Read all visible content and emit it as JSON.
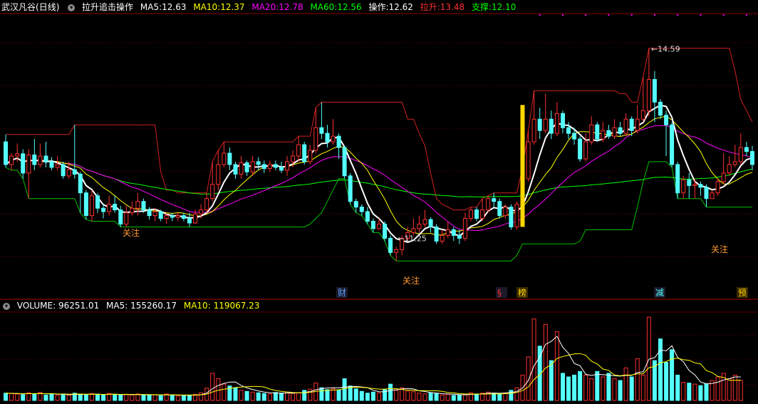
{
  "price_header": {
    "name": "武汉凡谷",
    "period": "(日线)",
    "indicator": "拉升追击操作",
    "ma5": {
      "label": "MA5:",
      "value": "12.63",
      "color": "#ffffff"
    },
    "ma10": {
      "label": "MA10:",
      "value": "12.37",
      "color": "#ffff00"
    },
    "ma20": {
      "label": "MA20:",
      "value": "12.78",
      "color": "#ff00ff"
    },
    "ma60": {
      "label": "MA60:",
      "value": "12.56",
      "color": "#00ff00"
    },
    "op": {
      "label": "操作:",
      "value": "12.62",
      "color": "#ffffff"
    },
    "lift": {
      "label": "拉升:",
      "value": "13.48",
      "color": "#ff3030"
    },
    "support": {
      "label": "支撑:",
      "value": "12.10",
      "color": "#00ff00"
    }
  },
  "volume_header": {
    "volume": {
      "label": "VOLUME:",
      "value": "96251.01",
      "color": "#ffffff"
    },
    "ma5": {
      "label": "MA5:",
      "value": "155260.17",
      "color": "#ffffff"
    },
    "ma10": {
      "label": "MA10:",
      "value": "119067.23",
      "color": "#ffff00"
    }
  },
  "chart_data": [
    {
      "type": "candlestick",
      "title": "武汉凡谷(日线)",
      "ylim": [
        10.3,
        15.2
      ],
      "grid": true,
      "up_color": "#ff3030",
      "down_color": "#54ffff",
      "candles": [
        [
          12.95,
          12.55,
          13.08,
          12.5
        ],
        [
          12.55,
          12.7,
          12.75,
          12.45
        ],
        [
          12.7,
          12.74,
          12.92,
          12.6
        ],
        [
          12.74,
          12.4,
          12.82,
          12.3
        ],
        [
          12.4,
          12.72,
          12.82,
          11.95
        ],
        [
          12.72,
          12.55,
          13.0,
          12.45
        ],
        [
          12.55,
          12.7,
          12.92,
          12.5
        ],
        [
          12.7,
          12.6,
          12.95,
          12.5
        ],
        [
          12.6,
          12.5,
          12.68,
          12.45
        ],
        [
          12.5,
          12.55,
          12.7,
          12.45
        ],
        [
          12.55,
          12.35,
          12.6,
          12.3
        ],
        [
          12.35,
          12.46,
          12.6,
          12.3
        ],
        [
          12.46,
          12.38,
          13.25,
          12.3
        ],
        [
          12.38,
          12.05,
          12.42,
          11.7
        ],
        [
          12.05,
          11.65,
          12.1,
          11.58
        ],
        [
          11.65,
          12.0,
          12.1,
          11.55
        ],
        [
          12.0,
          11.78,
          12.05,
          11.7
        ],
        [
          11.78,
          11.72,
          11.85,
          11.6
        ],
        [
          11.72,
          11.85,
          12.0,
          11.65
        ],
        [
          11.85,
          11.75,
          12.0,
          11.7
        ],
        [
          11.75,
          11.5,
          11.82,
          11.45
        ],
        [
          11.5,
          11.7,
          11.82,
          11.45
        ],
        [
          11.7,
          11.78,
          11.9,
          11.65
        ],
        [
          11.78,
          11.9,
          12.05,
          11.65
        ],
        [
          11.9,
          11.75,
          11.95,
          11.7
        ],
        [
          11.75,
          11.65,
          11.8,
          11.58
        ],
        [
          11.65,
          11.72,
          11.78,
          11.55
        ],
        [
          11.72,
          11.6,
          11.75,
          11.55
        ],
        [
          11.6,
          11.65,
          11.7,
          11.5
        ],
        [
          11.65,
          11.62,
          11.7,
          11.55
        ],
        [
          11.62,
          11.65,
          11.7,
          11.55
        ],
        [
          11.65,
          11.6,
          11.7,
          11.55
        ],
        [
          11.6,
          11.52,
          11.7,
          11.45
        ],
        [
          11.52,
          11.68,
          11.75,
          11.5
        ],
        [
          11.68,
          11.75,
          11.85,
          11.6
        ],
        [
          11.75,
          11.95,
          12.05,
          11.7
        ],
        [
          11.95,
          12.2,
          12.6,
          11.9
        ],
        [
          12.2,
          12.55,
          12.8,
          12.1
        ],
        [
          12.55,
          12.75,
          12.95,
          12.5
        ],
        [
          12.75,
          12.55,
          12.85,
          12.45
        ],
        [
          12.55,
          12.38,
          12.6,
          12.3
        ],
        [
          12.38,
          12.58,
          12.7,
          12.3
        ],
        [
          12.58,
          12.42,
          12.62,
          12.35
        ],
        [
          12.42,
          12.6,
          12.7,
          12.35
        ],
        [
          12.6,
          12.55,
          12.68,
          12.45
        ],
        [
          12.55,
          12.48,
          12.62,
          12.4
        ],
        [
          12.48,
          12.55,
          12.62,
          12.42
        ],
        [
          12.55,
          12.5,
          12.62,
          12.45
        ],
        [
          12.5,
          12.45,
          12.6,
          12.4
        ],
        [
          12.45,
          12.6,
          12.7,
          12.35
        ],
        [
          12.6,
          12.7,
          12.8,
          12.5
        ],
        [
          12.7,
          12.9,
          13.05,
          12.6
        ],
        [
          12.9,
          12.6,
          12.95,
          12.55
        ],
        [
          12.6,
          12.8,
          12.9,
          12.55
        ],
        [
          12.8,
          13.2,
          13.55,
          12.75
        ],
        [
          13.2,
          13.1,
          13.65,
          13.0
        ],
        [
          13.1,
          12.95,
          13.25,
          12.85
        ],
        [
          12.95,
          13.05,
          13.35,
          12.9
        ],
        [
          13.05,
          12.85,
          13.1,
          12.65
        ],
        [
          12.85,
          12.35,
          12.88,
          12.3
        ],
        [
          12.35,
          11.9,
          12.4,
          11.85
        ],
        [
          11.9,
          11.8,
          11.95,
          11.7
        ],
        [
          11.8,
          11.72,
          11.85,
          11.65
        ],
        [
          11.72,
          11.55,
          11.8,
          11.5
        ],
        [
          11.55,
          11.42,
          11.6,
          11.35
        ],
        [
          11.42,
          11.5,
          11.6,
          11.4
        ],
        [
          11.5,
          11.25,
          11.55,
          11.2
        ],
        [
          11.25,
          11.0,
          11.3,
          10.95
        ],
        [
          11.0,
          11.05,
          11.1,
          10.85
        ],
        [
          11.05,
          11.25,
          11.3,
          10.95
        ],
        [
          11.25,
          11.35,
          11.45,
          11.2
        ],
        [
          11.35,
          11.42,
          11.6,
          11.3
        ],
        [
          11.42,
          11.5,
          11.65,
          11.35
        ],
        [
          11.5,
          11.58,
          11.75,
          11.45
        ],
        [
          11.58,
          11.45,
          11.62,
          11.35
        ],
        [
          11.45,
          11.2,
          11.5,
          11.15
        ],
        [
          11.2,
          11.3,
          11.4,
          11.15
        ],
        [
          11.3,
          11.4,
          11.55,
          11.25
        ],
        [
          11.4,
          11.3,
          11.45,
          11.2
        ],
        [
          11.3,
          11.25,
          11.4,
          11.15
        ],
        [
          11.25,
          11.6,
          11.7,
          11.2
        ],
        [
          11.6,
          11.75,
          11.8,
          11.55
        ],
        [
          11.75,
          11.6,
          11.8,
          11.55
        ],
        [
          11.6,
          11.75,
          11.95,
          11.55
        ],
        [
          11.75,
          11.95,
          12.0,
          11.7
        ],
        [
          11.95,
          11.9,
          12.05,
          11.8
        ],
        [
          11.9,
          11.65,
          11.95,
          11.6
        ],
        [
          11.65,
          11.8,
          11.85,
          11.6
        ],
        [
          11.8,
          11.45,
          11.85,
          11.4
        ],
        [
          11.45,
          11.85,
          11.9,
          11.4
        ],
        [
          11.85,
          12.3,
          12.5,
          11.8
        ],
        [
          12.3,
          12.95,
          13.15,
          12.25
        ],
        [
          12.95,
          13.35,
          13.85,
          12.9
        ],
        [
          13.35,
          13.15,
          13.55,
          13.0
        ],
        [
          13.15,
          13.35,
          13.8,
          13.1
        ],
        [
          13.35,
          13.1,
          13.5,
          13.0
        ],
        [
          13.1,
          13.45,
          13.65,
          13.05
        ],
        [
          13.45,
          13.2,
          13.5,
          13.1
        ],
        [
          13.2,
          13.1,
          13.3,
          13.0
        ],
        [
          13.1,
          13.0,
          13.2,
          12.9
        ],
        [
          13.0,
          12.65,
          13.05,
          12.6
        ],
        [
          12.65,
          12.95,
          13.1,
          12.6
        ],
        [
          12.95,
          13.25,
          13.4,
          12.9
        ],
        [
          13.25,
          13.0,
          13.3,
          12.95
        ],
        [
          13.0,
          13.15,
          13.3,
          12.95
        ],
        [
          13.15,
          13.05,
          13.25,
          13.0
        ],
        [
          13.05,
          13.2,
          13.35,
          13.0
        ],
        [
          13.2,
          13.1,
          13.3,
          13.05
        ],
        [
          13.1,
          13.35,
          13.45,
          13.05
        ],
        [
          13.35,
          13.15,
          13.4,
          13.05
        ],
        [
          13.15,
          13.35,
          13.6,
          13.1
        ],
        [
          13.35,
          13.5,
          14.1,
          13.3
        ],
        [
          13.5,
          14.05,
          14.6,
          13.4
        ],
        [
          14.05,
          13.65,
          14.2,
          13.3
        ],
        [
          13.65,
          13.42,
          13.7,
          13.35
        ],
        [
          13.42,
          13.25,
          13.5,
          12.7
        ],
        [
          13.25,
          12.55,
          13.3,
          12.5
        ],
        [
          12.55,
          12.05,
          12.6,
          11.95
        ],
        [
          12.05,
          12.28,
          12.35,
          11.95
        ],
        [
          12.28,
          12.18,
          12.4,
          11.95
        ],
        [
          12.18,
          12.2,
          12.3,
          11.95
        ],
        [
          12.2,
          12.15,
          12.25,
          12.0
        ],
        [
          12.15,
          11.95,
          12.2,
          11.8
        ],
        [
          11.95,
          12.05,
          12.1,
          11.95
        ],
        [
          12.05,
          12.25,
          12.3,
          12.0
        ],
        [
          12.25,
          12.4,
          12.75,
          12.2
        ],
        [
          12.4,
          12.55,
          12.7,
          12.35
        ],
        [
          12.55,
          12.6,
          12.9,
          12.5
        ],
        [
          12.6,
          12.85,
          13.1,
          12.55
        ],
        [
          12.85,
          12.78,
          12.95,
          12.7
        ],
        [
          12.78,
          12.55,
          12.88,
          12.45
        ]
      ],
      "markers": [
        {
          "label": "14.59",
          "value": 14.59
        },
        {
          "label": "11.25",
          "value": 11.25
        }
      ],
      "annotations": [
        "关注",
        "关注",
        "关注"
      ],
      "event_labels": [
        {
          "text": "财",
          "color": "#5aa0ff"
        },
        {
          "text": "§",
          "color": "#ff3030"
        },
        {
          "text": "榜",
          "color": "#ffd700"
        },
        {
          "text": "减",
          "color": "#54ffff"
        },
        {
          "text": "预",
          "color": "#ffd700"
        }
      ]
    },
    {
      "type": "bar",
      "title": "VOLUME",
      "series_name": "VOLUME",
      "ylim": [
        0,
        480000
      ],
      "volumes": [
        40000,
        38000,
        36000,
        32000,
        42000,
        36000,
        44000,
        30000,
        34000,
        28000,
        36000,
        30000,
        40000,
        34000,
        30000,
        38000,
        34000,
        30000,
        38000,
        32000,
        30000,
        34000,
        30000,
        36000,
        28000,
        30000,
        32000,
        26000,
        36000,
        30000,
        24000,
        28000,
        30000,
        34000,
        42000,
        68000,
        150000,
        120000,
        90000,
        80000,
        70000,
        56000,
        50000,
        46000,
        42000,
        38000,
        36000,
        44000,
        40000,
        46000,
        38000,
        42000,
        56000,
        62000,
        96000,
        70000,
        60000,
        64000,
        58000,
        120000,
        80000,
        64000,
        50000,
        40000,
        46000,
        42000,
        60000,
        90000,
        56000,
        70000,
        52000,
        48000,
        40000,
        36000,
        42000,
        38000,
        30000,
        34000,
        28000,
        30000,
        34000,
        42000,
        36000,
        40000,
        46000,
        40000,
        36000,
        42000,
        56000,
        70000,
        140000,
        240000,
        450000,
        300000,
        420000,
        220000,
        380000,
        150000,
        130000,
        140000,
        160000,
        140000,
        120000,
        160000,
        130000,
        150000,
        120000,
        110000,
        180000,
        130000,
        230000,
        140000,
        460000,
        220000,
        340000,
        210000,
        280000,
        140000,
        100000,
        96000,
        90000,
        82000,
        92000,
        110000,
        130000,
        150000,
        120000,
        140000,
        110000
      ]
    }
  ]
}
